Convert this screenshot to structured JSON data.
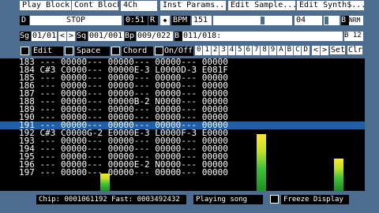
{
  "toolbar1": {
    "play_block": "Play Block",
    "cont_block": "Cont Block",
    "channels": "4Ch",
    "inst_params": "Inst Params...",
    "edit_sample": "Edit Sample...",
    "edit_synth": "Edit Synth$..."
  },
  "toolbar2": {
    "d_label": "D",
    "status": "STOP",
    "time": "0:51",
    "r_label": "R",
    "bpm_label": "BPM",
    "bpm_value": "151",
    "tempo2": "04",
    "b_label": "B",
    "nrm": "NRM"
  },
  "toolbar3": {
    "sg_label": "Sg",
    "sg_value": "01/01",
    "sq_value": "001/001",
    "bp_label": "Bp",
    "bp_value": "009/022",
    "b_label": "B",
    "block_value": "011/018:",
    "b12": "B 12"
  },
  "toolbar4": {
    "edit": "Edit",
    "space": "Space",
    "chord": "Chord",
    "onoff": "On/Off",
    "channels": [
      "0",
      "1",
      "2",
      "3",
      "4",
      "5",
      "6",
      "7",
      "8",
      "9",
      "A",
      "B",
      "C",
      "D"
    ],
    "set": "Set",
    "clr": "Clr"
  },
  "pattern": {
    "rows": [
      {
        "num": "183",
        "text": "--- 00000--- 00000--- 00000--- 00000"
      },
      {
        "num": "184",
        "text": "C#3 C0000--- 00000E-3 L0000D-3 E081F"
      },
      {
        "num": "185",
        "text": "--- 00000--- 00000--- 00000--- 00000"
      },
      {
        "num": "186",
        "text": "--- 00000--- 00000--- 00000--- 00000"
      },
      {
        "num": "187",
        "text": "--- 00000--- 00000--- 00000--- 00000"
      },
      {
        "num": "188",
        "text": "--- 00000--- 00000B-2 N0000--- 00000"
      },
      {
        "num": "189",
        "text": "--- 00000--- 00000--- 00000--- 00000"
      },
      {
        "num": "190",
        "text": "--- 00000--- 00000--- 00000--- 00000"
      },
      {
        "num": "191",
        "text": "--- 00000--- 00000--- 00000--- 00000"
      },
      {
        "num": "192",
        "text": "C#3 C0000G-2 E0000E-3 L0000F-3 E0000"
      },
      {
        "num": "193",
        "text": "--- 00000--- 00000--- 00000--- 00000"
      },
      {
        "num": "194",
        "text": "--- 00000--- 00000--- 00000--- 00000"
      },
      {
        "num": "195",
        "text": "--- 00000--- 00000--- 00000--- 00000"
      },
      {
        "num": "196",
        "text": "--- 00000--- 00000E-2 N0000--- 00000"
      },
      {
        "num": "197",
        "text": "--- 00000--- 00000--- 00000--- 00000"
      }
    ],
    "highlight_row": "190",
    "vu_levels": [
      0.3,
      0,
      0.95,
      0.55
    ]
  },
  "statusbar": {
    "memory": "Chip: 0001061192  Fast: 0003492432",
    "message": "Playing song",
    "freeze": "Freeze Display"
  },
  "colors": {
    "accent": "#4c6d8f",
    "highlight": "#1f5fa8",
    "background": "#000000"
  }
}
